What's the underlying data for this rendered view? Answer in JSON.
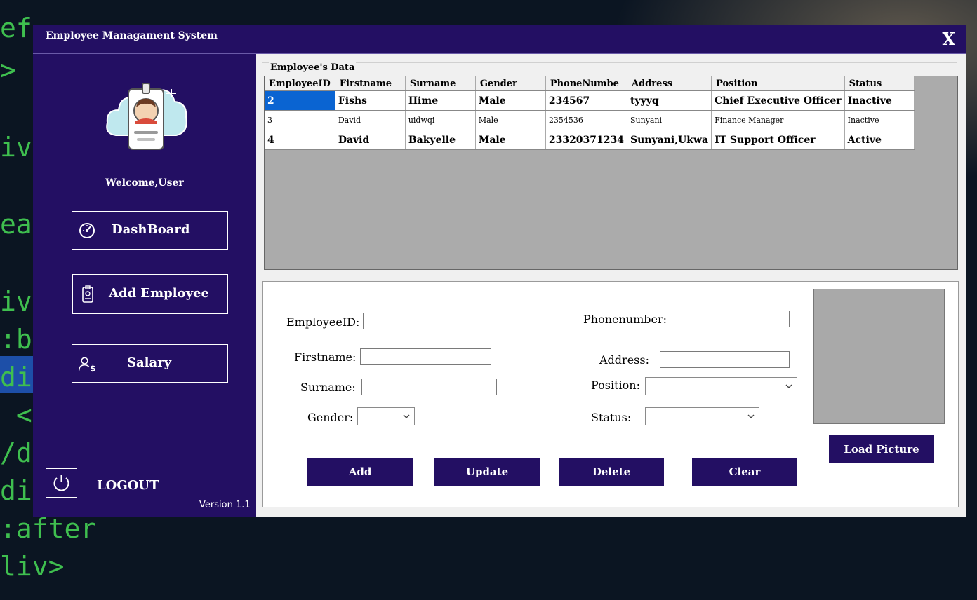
{
  "window": {
    "title": "Employee Managament System",
    "close_label": "X"
  },
  "sidebar": {
    "welcome": "Welcome,User",
    "nav": [
      {
        "label": "DashBoard",
        "icon": "dashboard-gauge-icon"
      },
      {
        "label": "Add Employee",
        "icon": "id-badge-icon"
      },
      {
        "label": "Salary",
        "icon": "user-salary-icon"
      }
    ],
    "logout": "LOGOUT",
    "version": "Version 1.1"
  },
  "grid": {
    "legend": "Employee's Data",
    "columns": [
      "EmployeeID",
      "Firstname",
      "Surname",
      "Gender",
      "PhoneNumbe",
      "Address",
      "Position",
      "Status"
    ],
    "rows": [
      [
        "2",
        "Fishs",
        "Hime",
        "Male",
        "234567",
        "tyyyq",
        "Chief Executive Officer",
        "Inactive"
      ],
      [
        "3",
        "David",
        "uidwqi",
        "Male",
        "2354536",
        "Sunyani",
        "Finance Manager",
        "Inactive"
      ],
      [
        "4",
        "David",
        "Bakyelle",
        "Male",
        "23320371234",
        "Sunyani,Ukwa",
        "IT Support Officer",
        "Active"
      ]
    ]
  },
  "form": {
    "labels": {
      "employee_id": "EmployeeID:",
      "firstname": "Firstname:",
      "surname": "Surname:",
      "gender": "Gender:",
      "phonenumber": "Phonenumber:",
      "address": "Address:",
      "position": "Position:",
      "status": "Status:"
    },
    "values": {
      "employee_id": "",
      "firstname": "",
      "surname": "",
      "phonenumber": "",
      "address": "",
      "gender": "",
      "position": "",
      "status": ""
    },
    "buttons": {
      "add": "Add",
      "update": "Update",
      "delete": "Delete",
      "clear": "Clear",
      "load_picture": "Load Picture"
    }
  },
  "colors": {
    "accent": "#230f63",
    "selection": "#0a64d2",
    "grid_bg": "#ababab"
  }
}
